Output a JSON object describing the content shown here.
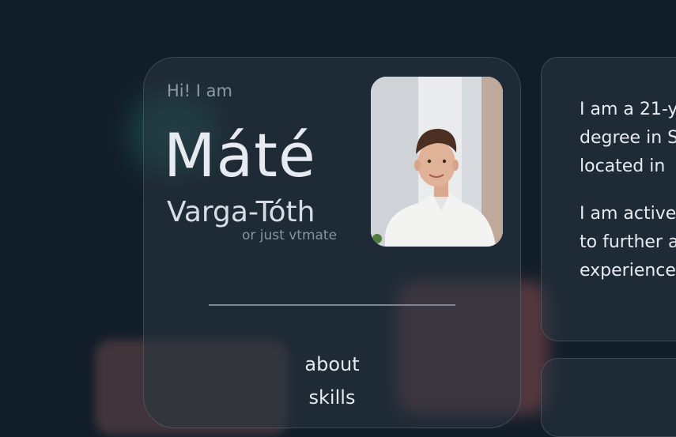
{
  "hero": {
    "greeting": "Hi! I am",
    "first_name": "Máté",
    "last_name": "Varga-Tóth",
    "handle": "or just vtmate"
  },
  "nav": {
    "items": [
      "about",
      "skills"
    ]
  },
  "bio": {
    "paragraph1_lines": [
      "I am a 21-y",
      "degree in S",
      "located in"
    ],
    "paragraph2_lines": [
      "I am active",
      "to further a",
      "experience"
    ]
  },
  "colors": {
    "background": "#121d2a",
    "card": "#283440",
    "accent_teal": "#1d4a4a",
    "accent_pink": "#5a3b41"
  }
}
